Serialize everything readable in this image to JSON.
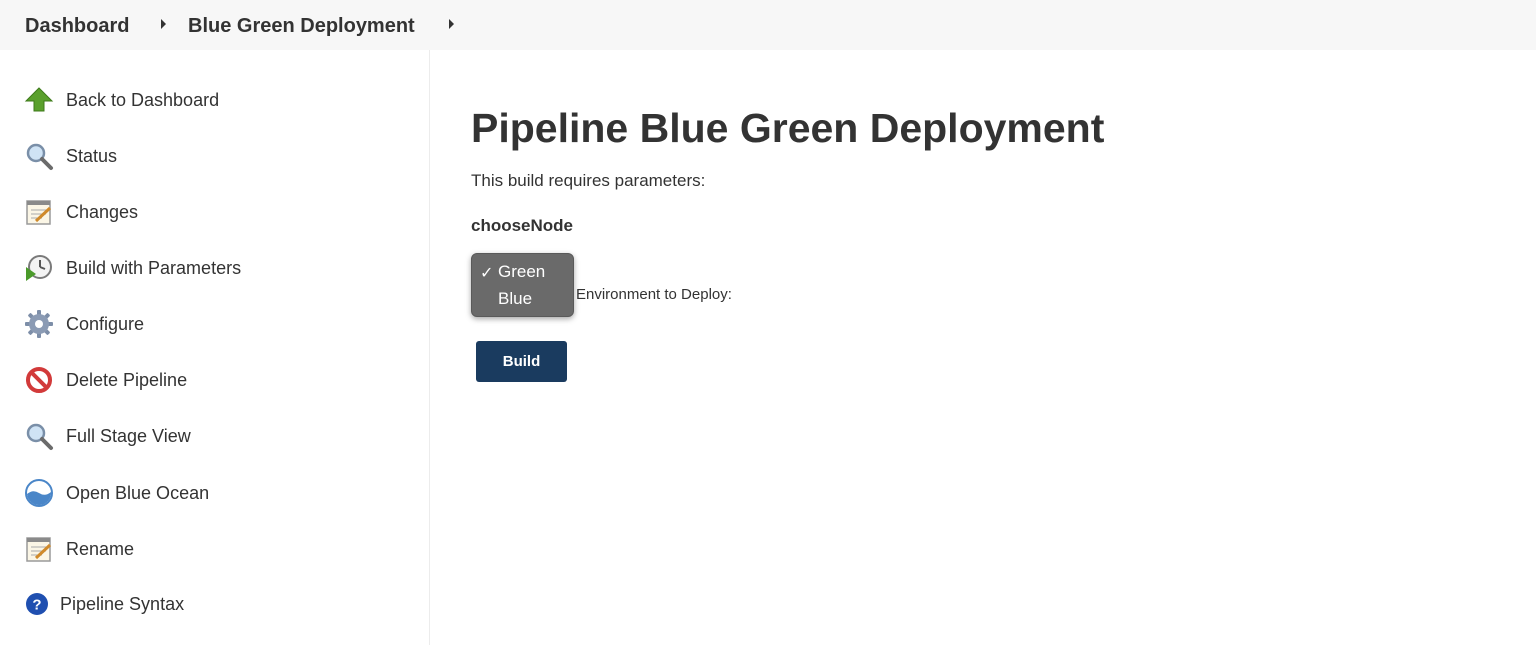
{
  "breadcrumb": {
    "items": [
      "Dashboard",
      "Blue Green Deployment"
    ]
  },
  "sidebar": {
    "items": [
      {
        "label": "Back to Dashboard",
        "icon": "up-arrow-icon"
      },
      {
        "label": "Status",
        "icon": "magnifier-icon"
      },
      {
        "label": "Changes",
        "icon": "notepad-icon"
      },
      {
        "label": "Build with Parameters",
        "icon": "clock-play-icon"
      },
      {
        "label": "Configure",
        "icon": "gear-icon"
      },
      {
        "label": "Delete Pipeline",
        "icon": "no-entry-icon"
      },
      {
        "label": "Full Stage View",
        "icon": "magnifier-icon"
      },
      {
        "label": "Open Blue Ocean",
        "icon": "blue-ocean-icon"
      },
      {
        "label": "Rename",
        "icon": "notepad-icon"
      },
      {
        "label": "Pipeline Syntax",
        "icon": "help-icon"
      }
    ]
  },
  "main": {
    "title": "Pipeline Blue Green Deployment",
    "subtitle": "This build requires parameters:",
    "param_name": "chooseNode",
    "param_description": "Environment to Deploy:",
    "options": [
      "Green",
      "Blue"
    ],
    "selected": "Green",
    "checkmark": "✓",
    "build_label": "Build"
  },
  "colors": {
    "build_button": "#1a3b5f",
    "dropdown_bg": "#6a6a6a",
    "topbar_bg": "#f7f7f7"
  }
}
